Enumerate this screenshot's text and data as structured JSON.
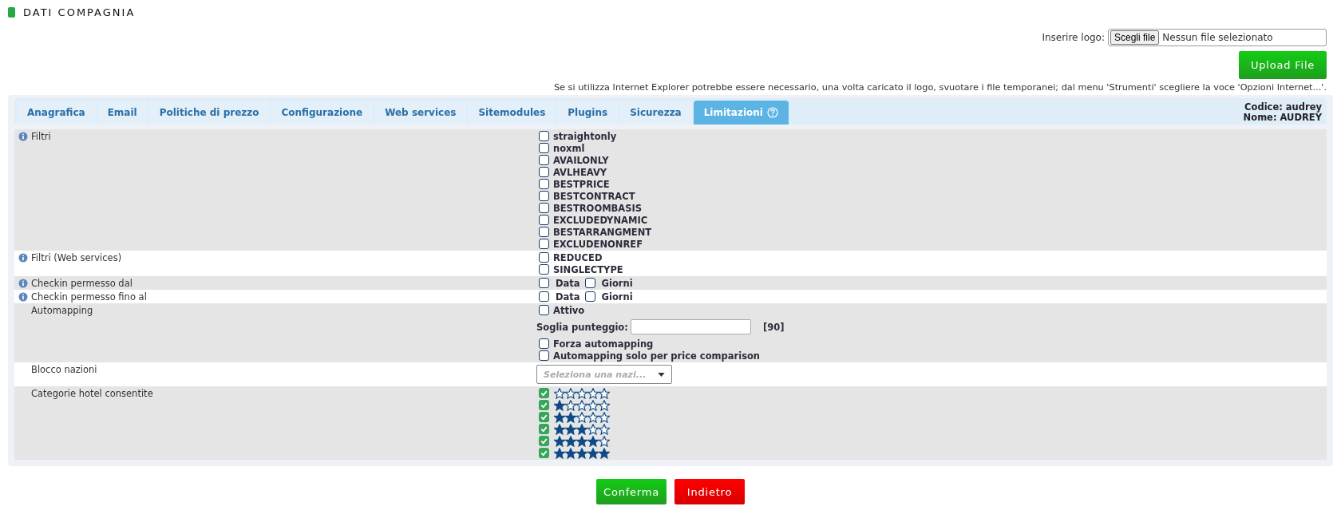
{
  "page_title": "DATI COMPAGNIA",
  "logo": {
    "label": "Inserire logo:",
    "button": "Scegli file",
    "file_name": "Nessun file selezionato",
    "upload": "Upload File"
  },
  "notice": "Se si utilizza Internet Explorer potrebbe essere necessario, una volta caricato il logo, svuotare i file temporanei; dal menu 'Strumenti' scegliere la voce 'Opzioni Internet...'.",
  "tabs": [
    {
      "label": "Anagrafica",
      "selected": false
    },
    {
      "label": "Email",
      "selected": false
    },
    {
      "label": "Politiche di prezzo",
      "selected": false
    },
    {
      "label": "Configurazione",
      "selected": false
    },
    {
      "label": "Web services",
      "selected": false
    },
    {
      "label": "Sitemodules",
      "selected": false
    },
    {
      "label": "Plugins",
      "selected": false
    },
    {
      "label": "Sicurezza",
      "selected": false
    },
    {
      "label": "Limitazioni",
      "selected": true,
      "help": true
    }
  ],
  "account": {
    "code": "Codice: audrey",
    "name": "Nome: AUDREY"
  },
  "rows": [
    {
      "kind": "checkboxes",
      "label": "Filtri",
      "info": true,
      "options": [
        {
          "label": "straightonly",
          "checked": false
        },
        {
          "label": "noxml",
          "checked": false
        },
        {
          "label": "AVAILONLY",
          "checked": false
        },
        {
          "label": "AVLHEAVY",
          "checked": false
        },
        {
          "label": "BESTPRICE",
          "checked": false
        },
        {
          "label": "BESTCONTRACT",
          "checked": false
        },
        {
          "label": "BESTROOMBASIS",
          "checked": false
        },
        {
          "label": "EXCLUDEDYNAMIC",
          "checked": false
        },
        {
          "label": "BESTARRANGMENT",
          "checked": false
        },
        {
          "label": "EXCLUDENONREF",
          "checked": false
        }
      ]
    },
    {
      "kind": "checkboxes",
      "label": "Filtri (Web services)",
      "info": true,
      "options": [
        {
          "label": "REDUCED",
          "checked": false
        },
        {
          "label": "SINGLECTYPE",
          "checked": false
        }
      ]
    },
    {
      "kind": "inline",
      "label": "Checkin permesso dal",
      "info": true,
      "options": [
        {
          "label": "Data",
          "checked": false
        },
        {
          "label": "Giorni",
          "checked": false
        }
      ]
    },
    {
      "kind": "inline",
      "label": "Checkin permesso fino al",
      "info": true,
      "options": [
        {
          "label": "Data",
          "checked": false
        },
        {
          "label": "Giorni",
          "checked": false
        }
      ]
    },
    {
      "kind": "automapping",
      "label": "Automapping",
      "info": false,
      "active": {
        "label": "Attivo",
        "checked": false
      },
      "threshold": {
        "label": "Soglia punteggio:",
        "hint": "[90]"
      },
      "options": [
        {
          "label": "Forza automapping",
          "checked": false
        },
        {
          "label": "Automapping solo per price comparison",
          "checked": false
        }
      ]
    },
    {
      "kind": "select",
      "label": "Blocco nazioni",
      "info": false,
      "placeholder": "Seleziona una nazi..."
    },
    {
      "kind": "stars",
      "label": "Categorie hotel consentite",
      "info": false,
      "categories": [
        {
          "stars": 0,
          "checked": true
        },
        {
          "stars": 1,
          "checked": true
        },
        {
          "stars": 2,
          "checked": true
        },
        {
          "stars": 3,
          "checked": true
        },
        {
          "stars": 4,
          "checked": true
        },
        {
          "stars": 5,
          "checked": true
        }
      ]
    }
  ],
  "buttons": [
    {
      "label": "Conferma",
      "kind": "confirm"
    },
    {
      "label": "Indietro",
      "kind": "back"
    }
  ]
}
